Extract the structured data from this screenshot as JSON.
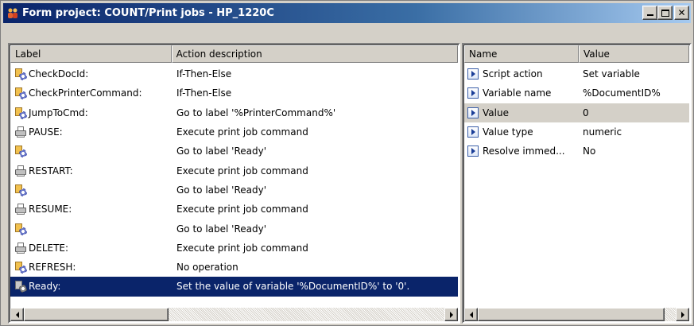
{
  "window": {
    "title": "Form project: COUNT/Print jobs - HP_1220C"
  },
  "left_table": {
    "columns": [
      "Label",
      "Action description"
    ],
    "rows": [
      {
        "label": "CheckDocId:",
        "action": "If-Then-Else",
        "icon": "gear-icon"
      },
      {
        "label": "CheckPrinterCommand:",
        "action": "If-Then-Else",
        "icon": "gear-icon"
      },
      {
        "label": "JumpToCmd:",
        "action": "Go to label '%PrinterCommand%'",
        "icon": "gear-icon"
      },
      {
        "label": "PAUSE:",
        "action": "Execute print job command",
        "icon": "printer-icon"
      },
      {
        "label": "",
        "action": "Go to label 'Ready'",
        "icon": "gear-icon"
      },
      {
        "label": "RESTART:",
        "action": "Execute print job command",
        "icon": "printer-icon"
      },
      {
        "label": "",
        "action": "Go to label 'Ready'",
        "icon": "gear-icon"
      },
      {
        "label": "RESUME:",
        "action": "Execute print job command",
        "icon": "printer-icon"
      },
      {
        "label": "",
        "action": "Go to label 'Ready'",
        "icon": "gear-icon"
      },
      {
        "label": "DELETE:",
        "action": "Execute print job command",
        "icon": "printer-icon"
      },
      {
        "label": "REFRESH:",
        "action": "No operation",
        "icon": "gear-icon"
      },
      {
        "label": "Ready:",
        "action": "Set the value of variable '%DocumentID%' to '0'.",
        "icon": "gear-icon",
        "selected": true
      }
    ]
  },
  "right_table": {
    "columns": [
      "Name",
      "Value"
    ],
    "rows": [
      {
        "name": "Script action",
        "value": "Set variable"
      },
      {
        "name": "Variable name",
        "value": "%DocumentID%"
      },
      {
        "name": "Value",
        "value": "0",
        "highlight": true
      },
      {
        "name": "Value type",
        "value": "numeric"
      },
      {
        "name": "Resolve immed...",
        "value": "No"
      }
    ]
  },
  "colors": {
    "selection": "#0a246a",
    "titlebar_start": "#0a246a",
    "titlebar_end": "#a6caf0",
    "face": "#d4d0c8"
  }
}
